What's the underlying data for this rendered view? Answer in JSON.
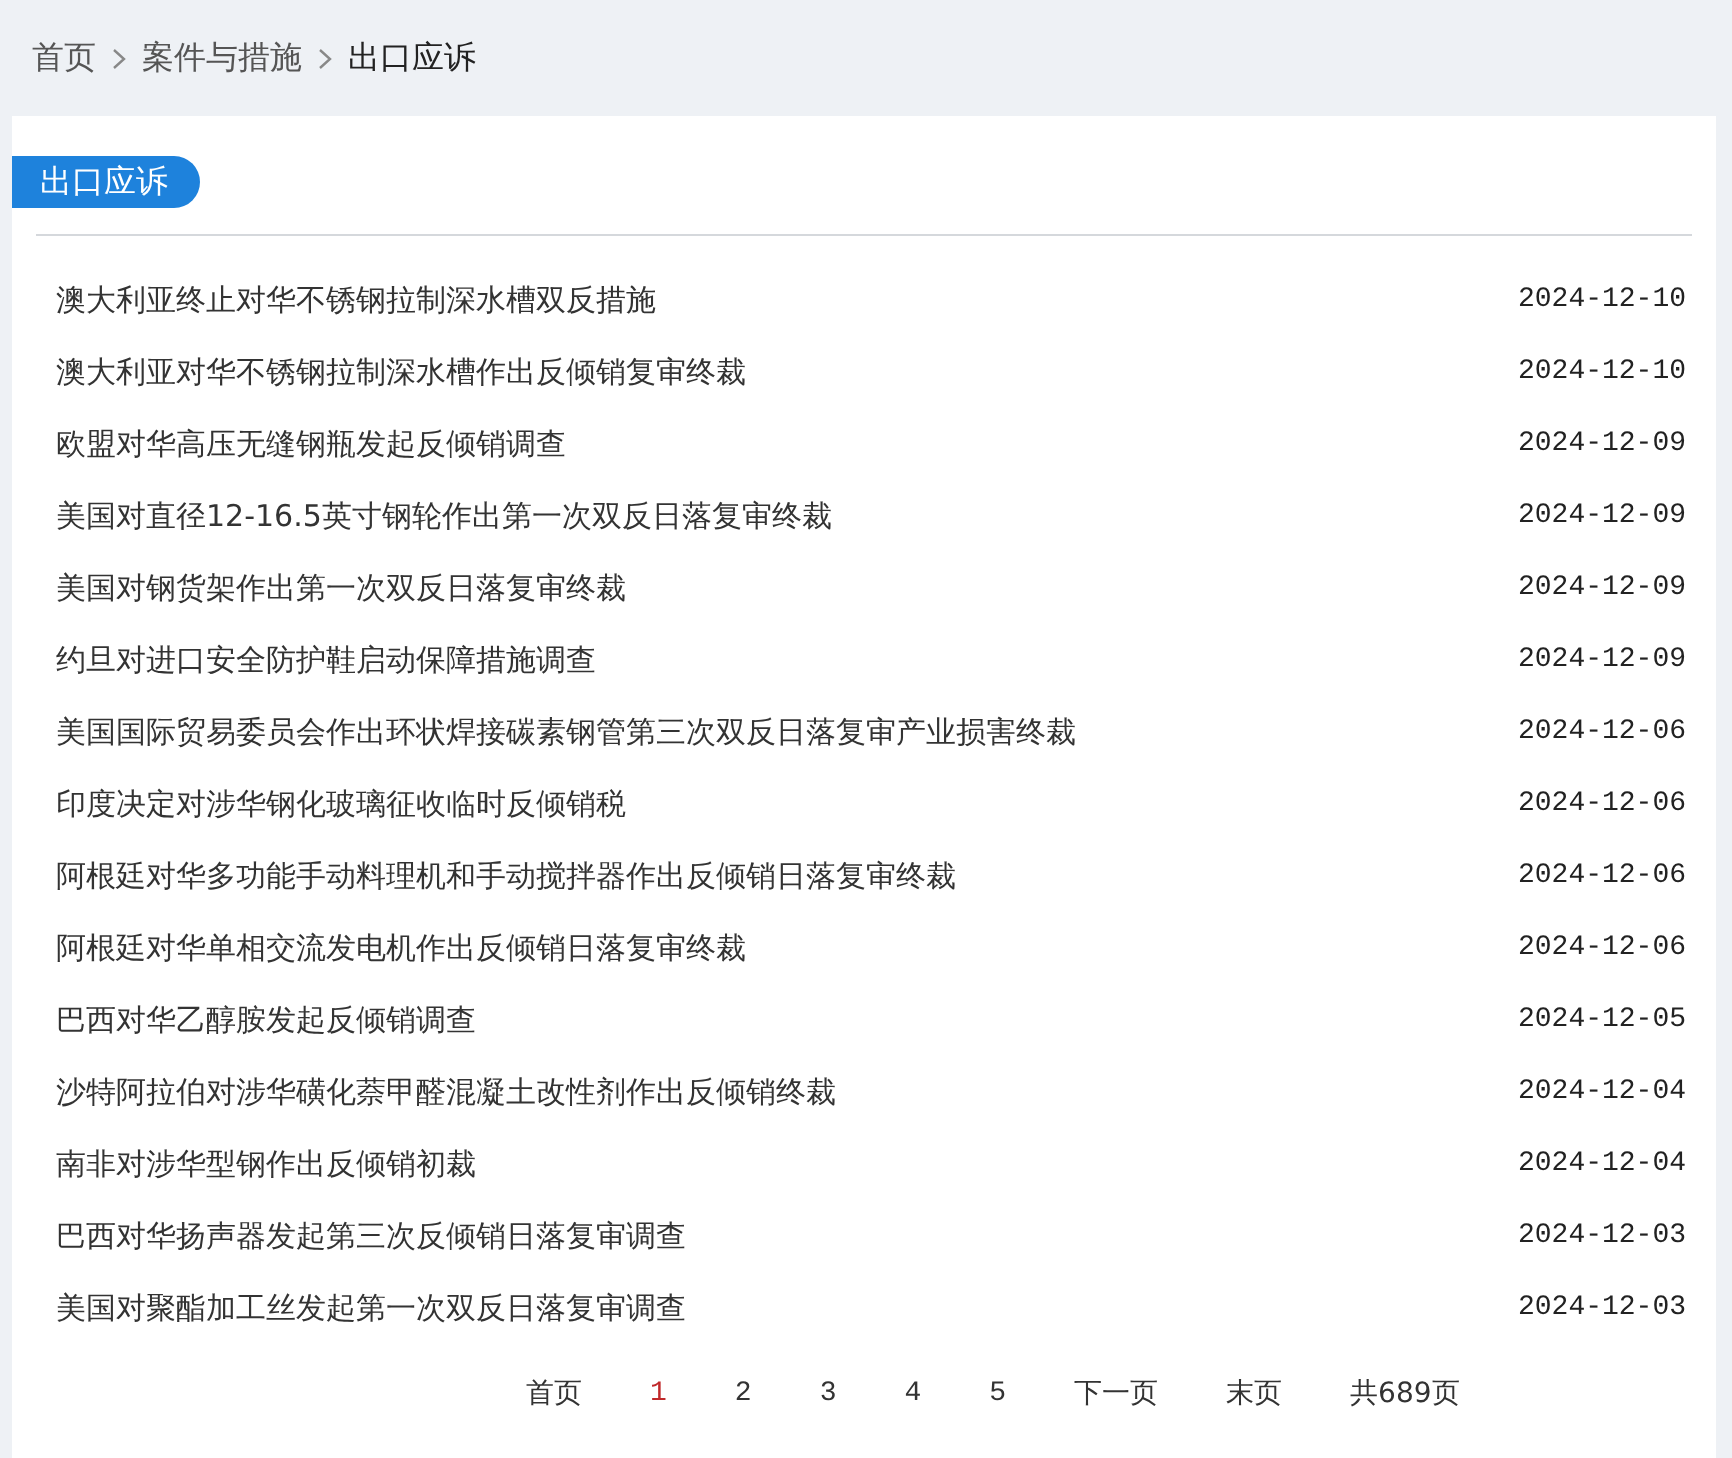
{
  "breadcrumb": [
    {
      "label": "首页",
      "current": false
    },
    {
      "label": "案件与措施",
      "current": false
    },
    {
      "label": "出口应诉",
      "current": true
    }
  ],
  "section_tag": "出口应诉",
  "articles": [
    {
      "title": "澳大利亚终止对华不锈钢拉制深水槽双反措施",
      "date": "2024-12-10"
    },
    {
      "title": "澳大利亚对华不锈钢拉制深水槽作出反倾销复审终裁",
      "date": "2024-12-10"
    },
    {
      "title": "欧盟对华高压无缝钢瓶发起反倾销调查",
      "date": "2024-12-09"
    },
    {
      "title": "美国对直径12-16.5英寸钢轮作出第一次双反日落复审终裁",
      "date": "2024-12-09"
    },
    {
      "title": "美国对钢货架作出第一次双反日落复审终裁",
      "date": "2024-12-09"
    },
    {
      "title": "约旦对进口安全防护鞋启动保障措施调查",
      "date": "2024-12-09"
    },
    {
      "title": "美国国际贸易委员会作出环状焊接碳素钢管第三次双反日落复审产业损害终裁",
      "date": "2024-12-06"
    },
    {
      "title": "印度决定对涉华钢化玻璃征收临时反倾销税",
      "date": "2024-12-06"
    },
    {
      "title": "阿根廷对华多功能手动料理机和手动搅拌器作出反倾销日落复审终裁",
      "date": "2024-12-06"
    },
    {
      "title": "阿根廷对华单相交流发电机作出反倾销日落复审终裁",
      "date": "2024-12-06"
    },
    {
      "title": "巴西对华乙醇胺发起反倾销调查",
      "date": "2024-12-05"
    },
    {
      "title": "沙特阿拉伯对涉华磺化萘甲醛混凝土改性剂作出反倾销终裁",
      "date": "2024-12-04"
    },
    {
      "title": "南非对涉华型钢作出反倾销初裁",
      "date": "2024-12-04"
    },
    {
      "title": "巴西对华扬声器发起第三次反倾销日落复审调查",
      "date": "2024-12-03"
    },
    {
      "title": "美国对聚酯加工丝发起第一次双反日落复审调查",
      "date": "2024-12-03"
    }
  ],
  "pagination": {
    "first": "首页",
    "pages": [
      {
        "label": "1",
        "selected": true
      },
      {
        "label": "2",
        "selected": false
      },
      {
        "label": "3",
        "selected": false
      },
      {
        "label": "4",
        "selected": false
      },
      {
        "label": "5",
        "selected": false
      }
    ],
    "next": "下一页",
    "last": "末页",
    "total": "共689页"
  }
}
